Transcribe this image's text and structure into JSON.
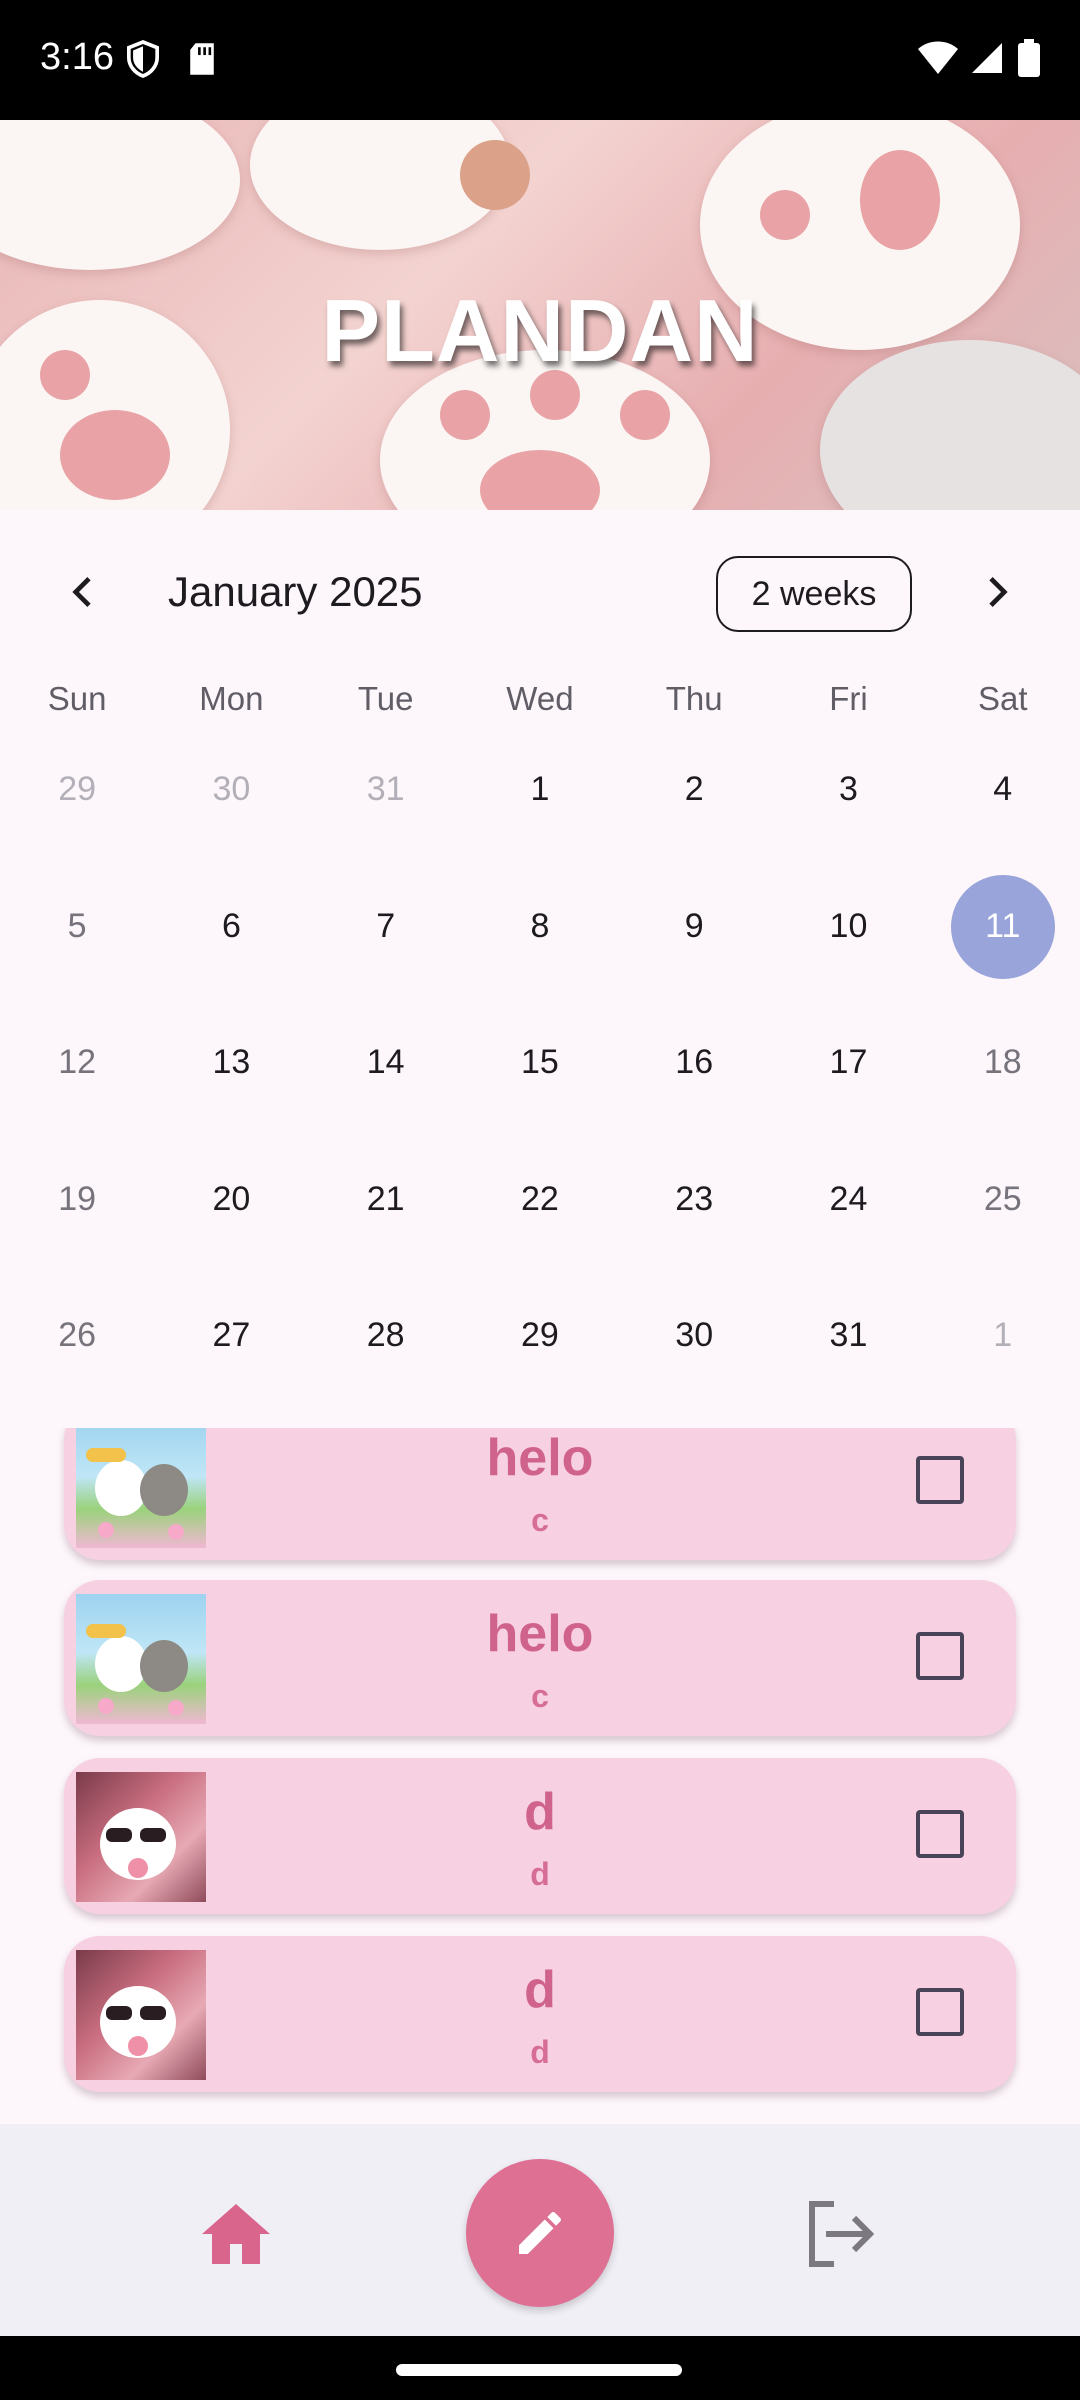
{
  "status": {
    "time": "3:16"
  },
  "banner": {
    "title": "PLANDAN"
  },
  "calendar": {
    "month_title": "January 2025",
    "format_button": "2 weeks",
    "weekdays": [
      "Sun",
      "Mon",
      "Tue",
      "Wed",
      "Thu",
      "Fri",
      "Sat"
    ],
    "weeks": [
      [
        "29",
        "30",
        "31",
        "1",
        "2",
        "3",
        "4"
      ],
      [
        "5",
        "6",
        "7",
        "8",
        "9",
        "10",
        "11"
      ],
      [
        "12",
        "13",
        "14",
        "15",
        "16",
        "17",
        "18"
      ],
      [
        "19",
        "20",
        "21",
        "22",
        "23",
        "24",
        "25"
      ],
      [
        "26",
        "27",
        "28",
        "29",
        "30",
        "31",
        "1"
      ]
    ],
    "selected_day": "11"
  },
  "tasks": [
    {
      "title": "helo",
      "subtitle": "c",
      "thumb": "cat-meadow-sticker",
      "checked": false
    },
    {
      "title": "helo",
      "subtitle": "c",
      "thumb": "cat-meadow-sticker",
      "checked": false
    },
    {
      "title": "d",
      "subtitle": "d",
      "thumb": "cat-sunglasses-sticker",
      "checked": false
    },
    {
      "title": "d",
      "subtitle": "d",
      "thumb": "cat-sunglasses-sticker",
      "checked": false
    }
  ],
  "nav": {
    "home_icon": "home-icon",
    "fab_icon": "pencil-icon",
    "logout_icon": "logout-icon"
  },
  "colors": {
    "accent": "#de7093",
    "selected_day": "#98a4da",
    "task_card": "#f7d0e2",
    "task_text": "#d0638c"
  }
}
